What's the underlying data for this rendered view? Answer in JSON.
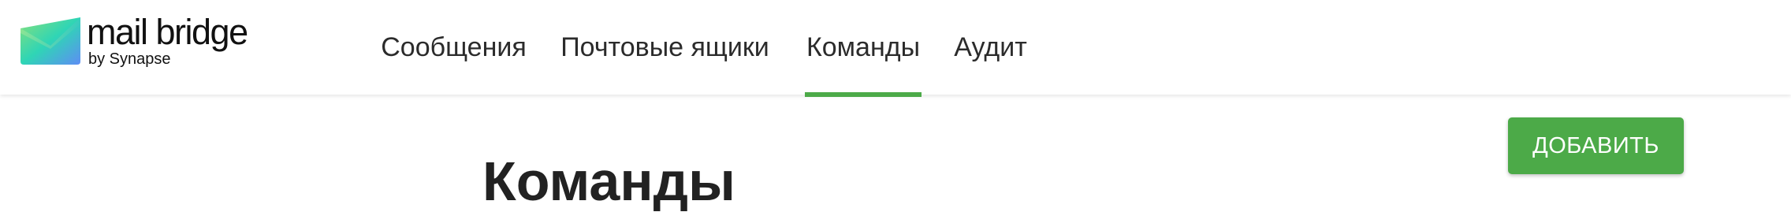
{
  "brand": {
    "name": "mail bridge",
    "byline": "by Synapse",
    "logo_icon": "envelope-gradient-logo",
    "gradient_colors": [
      "#7ddc7f",
      "#2fd5b5",
      "#5e8df5"
    ]
  },
  "nav": {
    "tabs": [
      {
        "label": "Сообщения",
        "active": false
      },
      {
        "label": "Почтовые ящики",
        "active": false
      },
      {
        "label": "Команды",
        "active": true
      },
      {
        "label": "Аудит",
        "active": false
      }
    ],
    "active_color": "#4caa48"
  },
  "main": {
    "title": "Команды",
    "add_button_label": "ДОБАВИТЬ",
    "add_button_color": "#4caa48"
  }
}
